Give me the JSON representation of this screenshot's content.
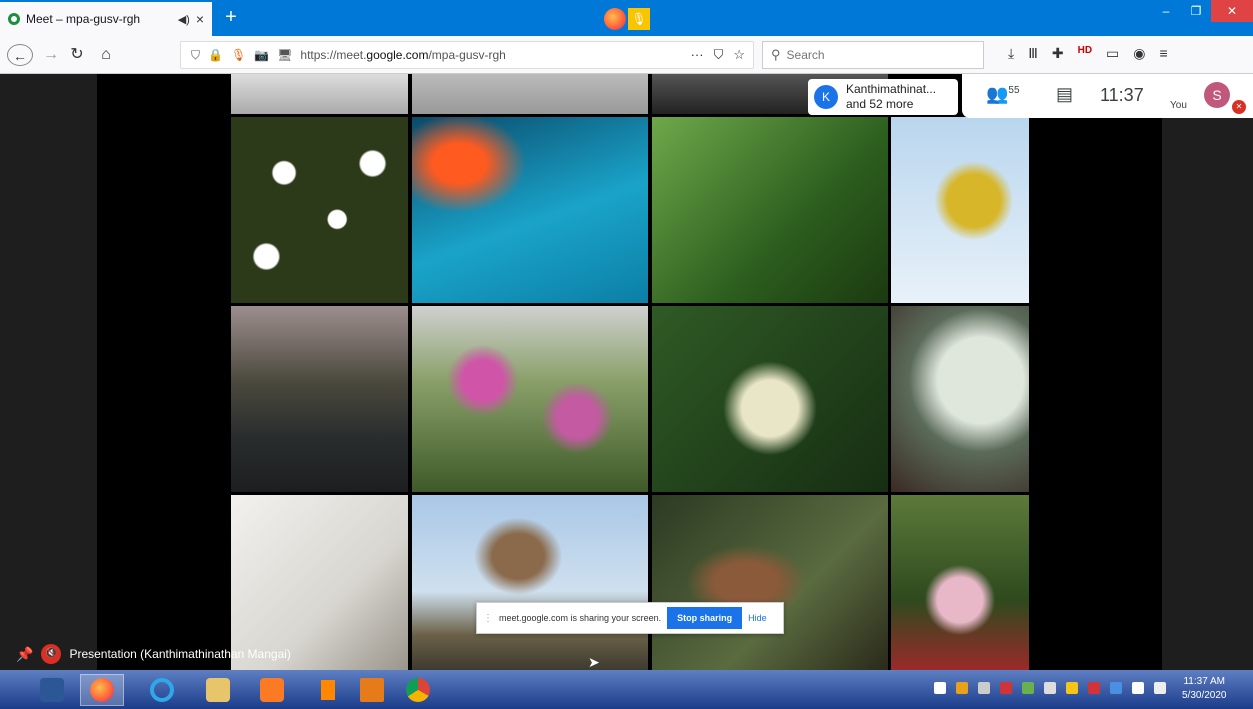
{
  "browser": {
    "tab_title": "Meet – mpa-gusv-rgh",
    "tab_sound_icon": "speaker-icon",
    "tab_close": "×",
    "new_tab": "+",
    "url_prefix": "https://meet.",
    "url_domain": "google.com",
    "url_path": "/mpa-gusv-rgh",
    "url_actions": "···",
    "search_placeholder": "Search"
  },
  "meet": {
    "participant_avatar_letter": "K",
    "participant_name": "Kanthimathinat...",
    "participant_more": "and 52 more",
    "people_icon": "people-icon",
    "people_count": "55",
    "chat_icon": "chat-icon",
    "time": "11:37",
    "you_label": "You",
    "you_avatar_letter": "S",
    "share_message": "meet.google.com is sharing your screen.",
    "stop_sharing_label": "Stop sharing",
    "hide_label": "Hide",
    "presentation_label": "Presentation (Kanthimathinathan Mangai)"
  },
  "taskbar": {
    "time": "11:37 AM",
    "date": "5/30/2020",
    "apps": [
      "word",
      "firefox",
      "internet-explorer",
      "file-explorer",
      "xampp",
      "vlc",
      "upload",
      "chrome"
    ]
  },
  "colors": {
    "tabbar": "#0078d7",
    "meet_blue": "#1a73e8",
    "danger": "#d93025",
    "taskbar": "#1b3c8a"
  }
}
